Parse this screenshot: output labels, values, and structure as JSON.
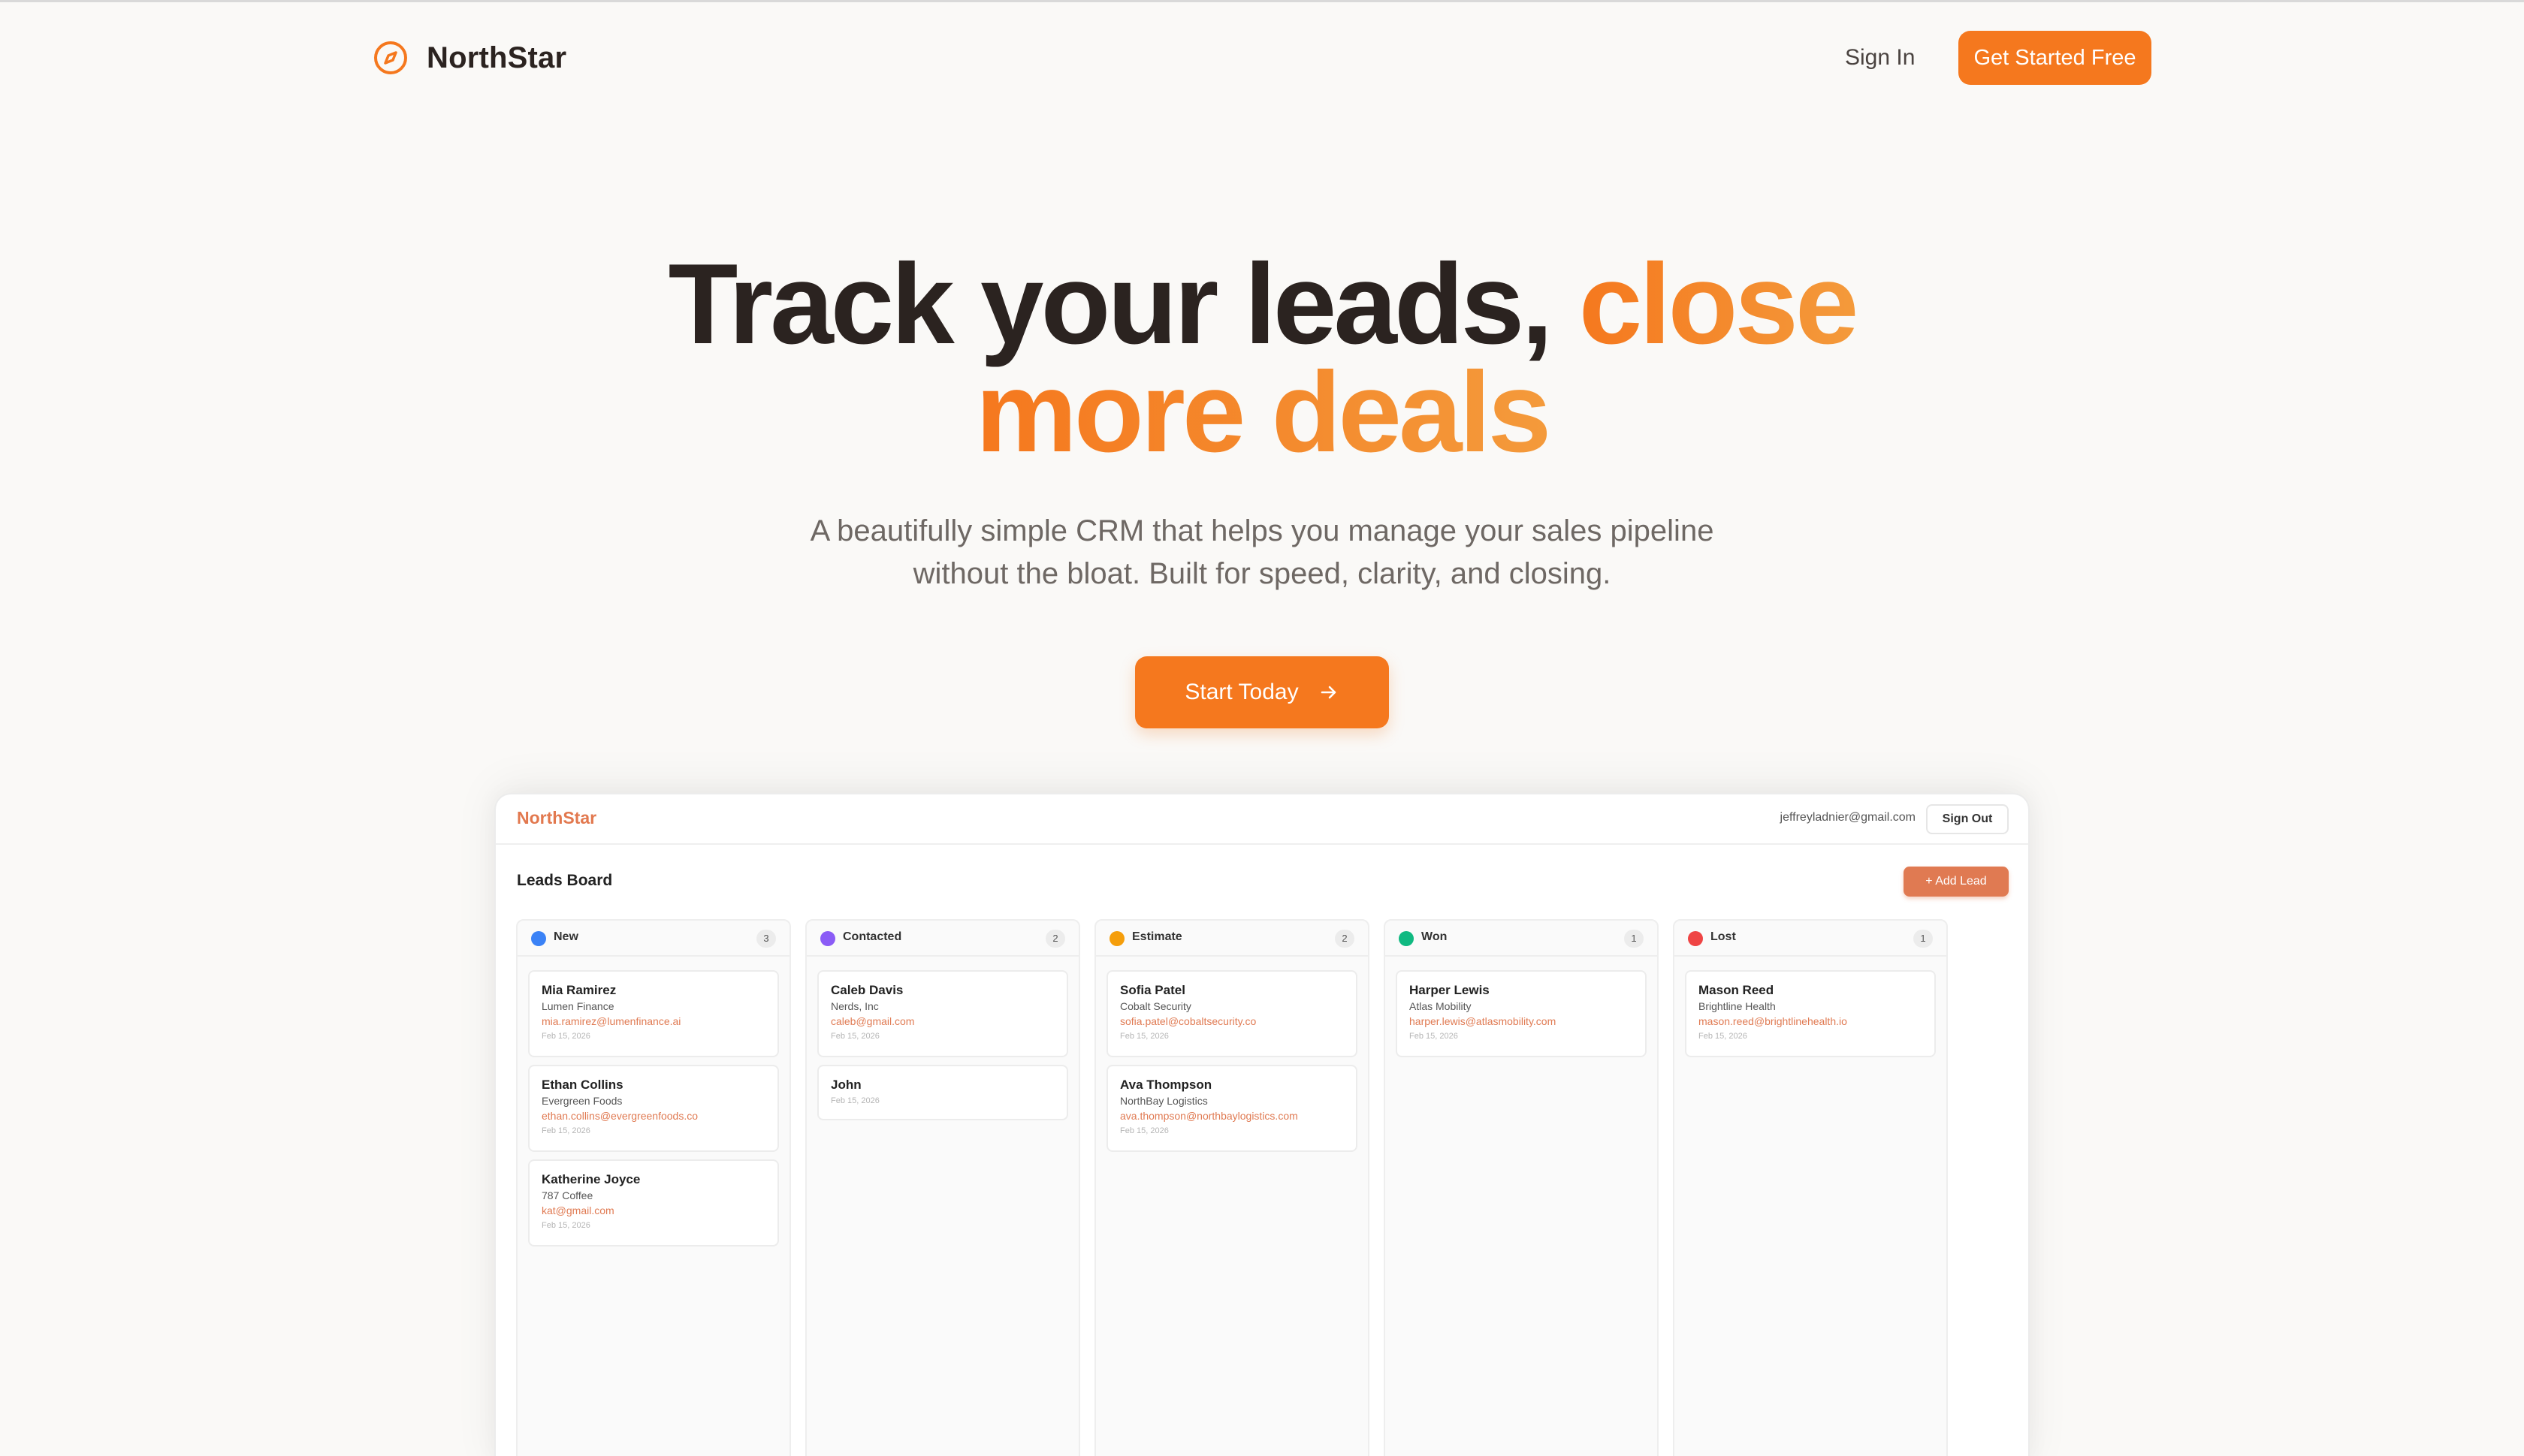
{
  "nav": {
    "brand": "NorthStar",
    "sign_in": "Sign In",
    "get_started": "Get Started Free"
  },
  "hero": {
    "title_part1": "Track your leads, ",
    "title_accent_line1": "close",
    "title_accent_line2": "more deals",
    "subtitle_line1": "A beautifully simple CRM that helps you manage your sales pipeline",
    "subtitle_line2": "without the bloat. Built for speed, clarity, and closing.",
    "cta": "Start Today",
    "cta_icon": "arrow-right-icon"
  },
  "colors": {
    "accent": "#f5781e",
    "accent_light": "#f49a3b",
    "app_accent": "#e07a52"
  },
  "preview": {
    "brand": "NorthStar",
    "user_email": "jeffreyladnier@gmail.com",
    "sign_out": "Sign Out",
    "board_title": "Leads Board",
    "add_lead": "+ Add Lead",
    "columns": [
      {
        "name": "New",
        "count": "3",
        "color": "#3b82f6",
        "cards": [
          {
            "name": "Mia Ramirez",
            "company": "Lumen Finance",
            "email": "mia.ramirez@lumenfinance.ai",
            "date": "Feb 15, 2026"
          },
          {
            "name": "Ethan Collins",
            "company": "Evergreen Foods",
            "email": "ethan.collins@evergreenfoods.co",
            "date": "Feb 15, 2026"
          },
          {
            "name": "Katherine Joyce",
            "company": "787 Coffee",
            "email": "kat@gmail.com",
            "date": "Feb 15, 2026"
          }
        ]
      },
      {
        "name": "Contacted",
        "count": "2",
        "color": "#8b5cf6",
        "cards": [
          {
            "name": "Caleb Davis",
            "company": "Nerds, Inc",
            "email": "caleb@gmail.com",
            "date": "Feb 15, 2026"
          },
          {
            "name": "John",
            "date": "Feb 15, 2026"
          }
        ]
      },
      {
        "name": "Estimate",
        "count": "2",
        "color": "#f59e0b",
        "cards": [
          {
            "name": "Sofia Patel",
            "company": "Cobalt Security",
            "email": "sofia.patel@cobaltsecurity.co",
            "date": "Feb 15, 2026"
          },
          {
            "name": "Ava Thompson",
            "company": "NorthBay Logistics",
            "email": "ava.thompson@northbaylogistics.com",
            "date": "Feb 15, 2026"
          }
        ]
      },
      {
        "name": "Won",
        "count": "1",
        "color": "#10b981",
        "cards": [
          {
            "name": "Harper Lewis",
            "company": "Atlas Mobility",
            "email": "harper.lewis@atlasmobility.com",
            "date": "Feb 15, 2026"
          }
        ]
      },
      {
        "name": "Lost",
        "count": "1",
        "color": "#ef4444",
        "cards": [
          {
            "name": "Mason Reed",
            "company": "Brightline Health",
            "email": "mason.reed@brightlinehealth.io",
            "date": "Feb 15, 2026"
          }
        ]
      }
    ]
  }
}
